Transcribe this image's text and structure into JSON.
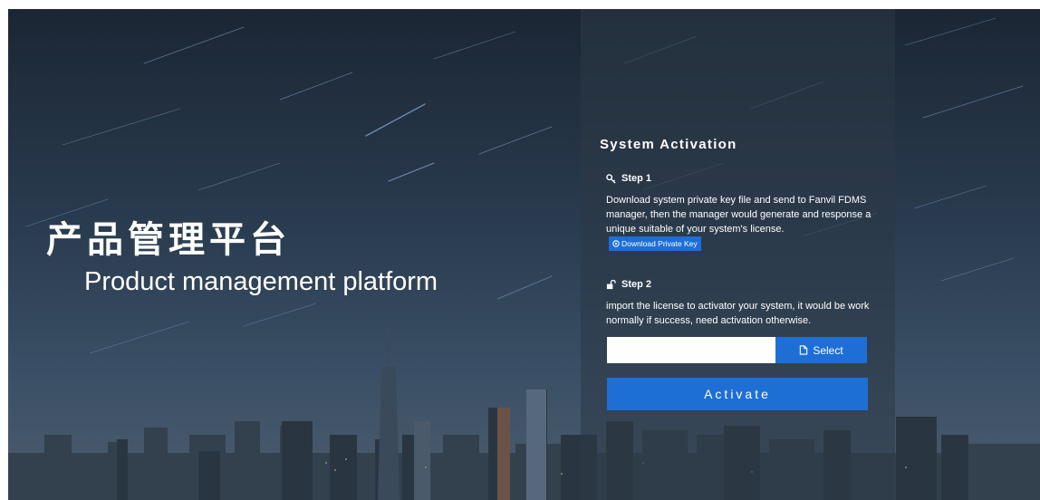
{
  "brand": {
    "title_cn": "产品管理平台",
    "title_en": "Product management platform"
  },
  "activation": {
    "title": "System Activation",
    "step1": {
      "heading": "Step 1",
      "icon": "key-icon",
      "description": "Download system private key file and send to Fanvil FDMS manager, then the manager would generate and response a unique suitable of your system's license.",
      "download_label": "Download Private Key"
    },
    "step2": {
      "heading": "Step 2",
      "icon": "unlock-icon",
      "description": "import the license to activator your system, it would be work normally if success, need activation otherwise."
    },
    "file_input": {
      "value": "",
      "placeholder": ""
    },
    "select_label": "Select",
    "activate_label": "Activate"
  },
  "colors": {
    "accent": "#1d6fd6",
    "panel_overlay": "rgba(44,56,70,0.55)",
    "text": "#ffffff"
  }
}
